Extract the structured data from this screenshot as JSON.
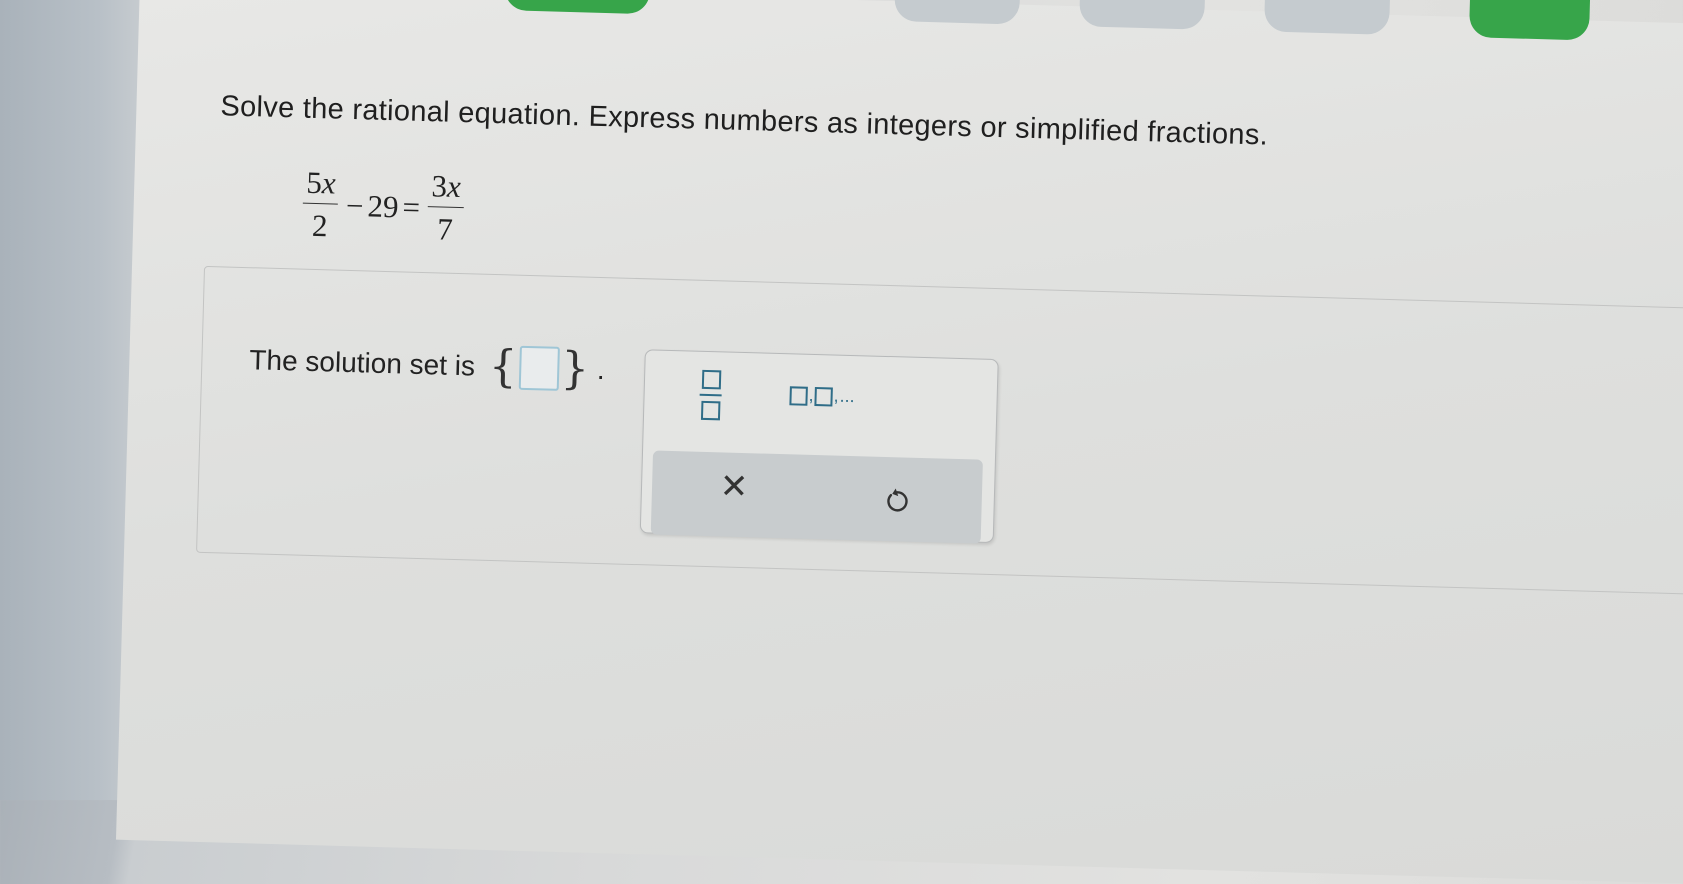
{
  "instruction": "Solve the rational equation. Express numbers as integers or simplified fractions.",
  "equation": {
    "left_frac_num": "5x",
    "left_frac_num_coef": "5",
    "left_frac_num_var": "x",
    "left_frac_den": "2",
    "minus": "−",
    "constant": "29",
    "equals": "=",
    "right_frac_num_coef": "3",
    "right_frac_num_var": "x",
    "right_frac_den": "7"
  },
  "answer": {
    "prompt": "The solution set is",
    "open_brace": "{",
    "close_brace": "}",
    "value": "",
    "period": "."
  },
  "palette": {
    "fraction_button": "fraction-template",
    "list_button_suffix": "...",
    "list_button_comma": ",",
    "clear_symbol": "✕",
    "undo_icon": "undo-icon"
  },
  "colors": {
    "accent_green": "#37a54a",
    "template_blue": "#2f6d88",
    "input_border": "#9fc6d6"
  }
}
